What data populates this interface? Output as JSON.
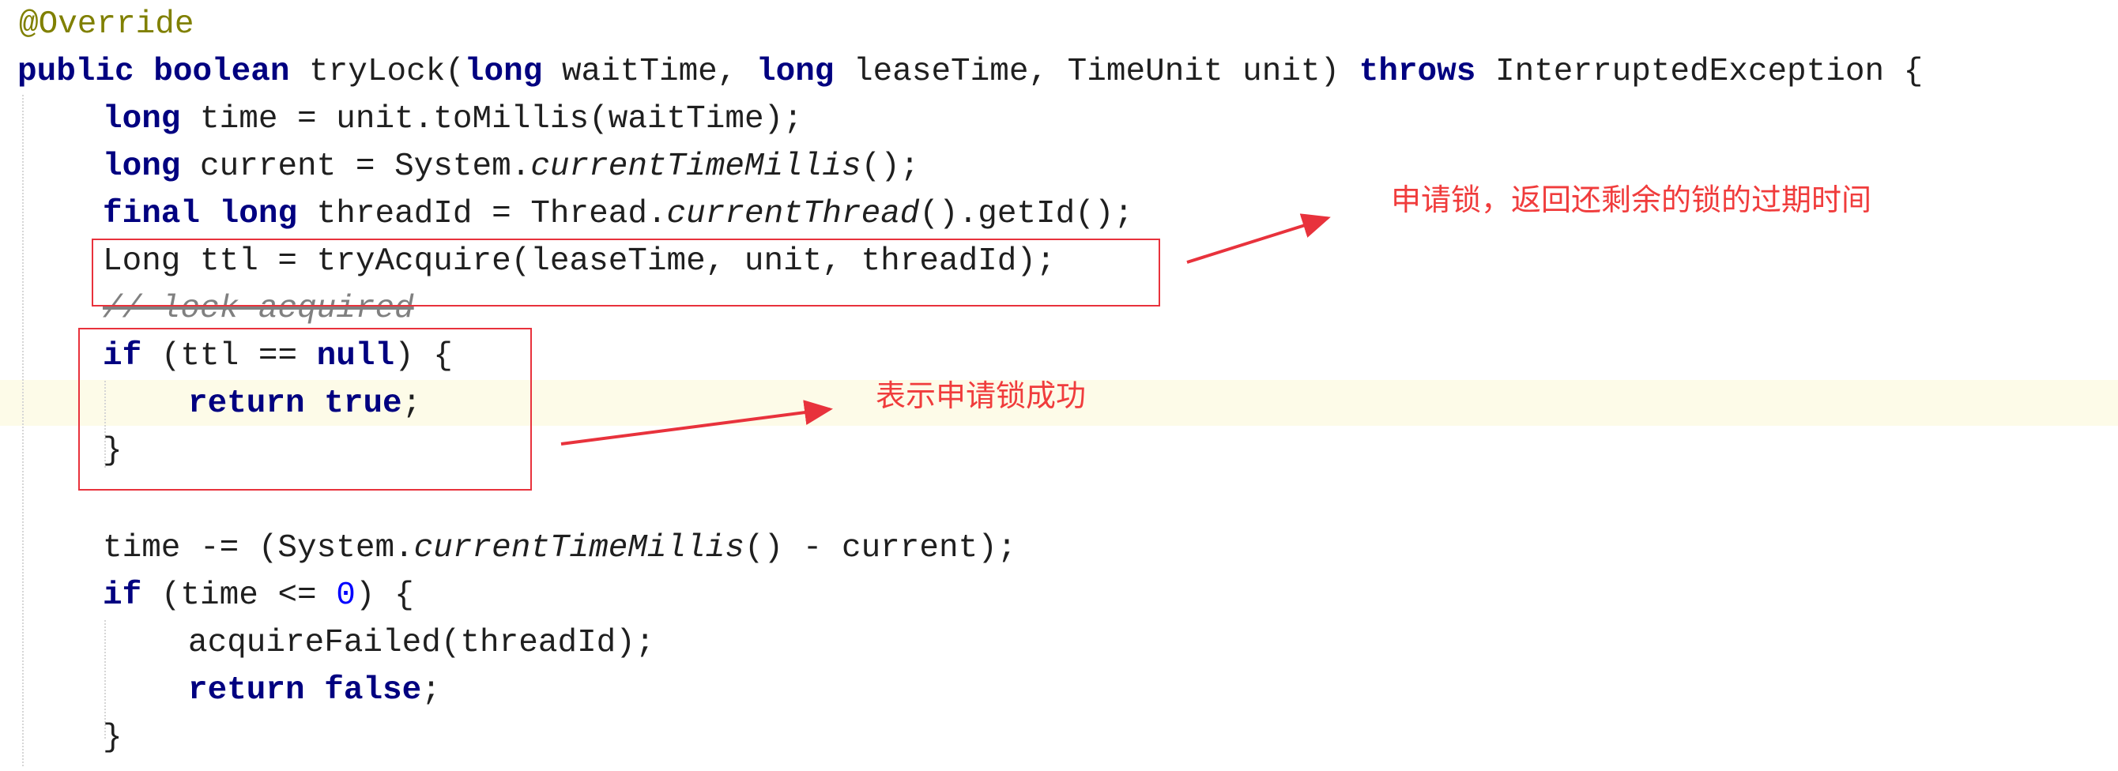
{
  "code": {
    "annotation": "@Override",
    "sig_public": "public",
    "sig_boolean": "boolean",
    "sig_name": "tryLock(",
    "sig_long1": "long",
    "sig_p1": "waitTime, ",
    "sig_long2": "long",
    "sig_p2": "leaseTime, TimeUnit unit) ",
    "sig_throws": "throws",
    "sig_rest": "InterruptedException {",
    "l2_long": "long",
    "l2_rest": "time = unit.toMillis(waitTime);",
    "l3_long": "long",
    "l3_a": "current = System.",
    "l3_it": "currentTimeMillis",
    "l3_b": "();",
    "l4_final": "final",
    "l4_long": "long",
    "l4_a": "threadId = Thread.",
    "l4_it": "currentThread",
    "l4_b": "().getId();",
    "l5": "Long ttl = tryAcquire(leaseTime, unit, threadId);",
    "l6_comment": "// lock acquired",
    "l7_if": "if",
    "l7_a": "(ttl == ",
    "l7_null": "null",
    "l7_b": ") {",
    "l8_return": "return",
    "l8_true": "true",
    "l8_semi": ";",
    "l9": "}",
    "l11_a": "time -= (System.",
    "l11_it": "currentTimeMillis",
    "l11_b": "() - current);",
    "l12_if": "if",
    "l12_a": "(time <= ",
    "l12_num": "0",
    "l12_b": ") {",
    "l13": "acquireFailed(threadId);",
    "l14_return": "return",
    "l14_false": "false",
    "l14_semi": ";",
    "l15": "}"
  },
  "annotations": {
    "note1": "申请锁，返回还剩余的锁的过期时间",
    "note2": "表示申请锁成功",
    "color": "#f03c3c"
  }
}
